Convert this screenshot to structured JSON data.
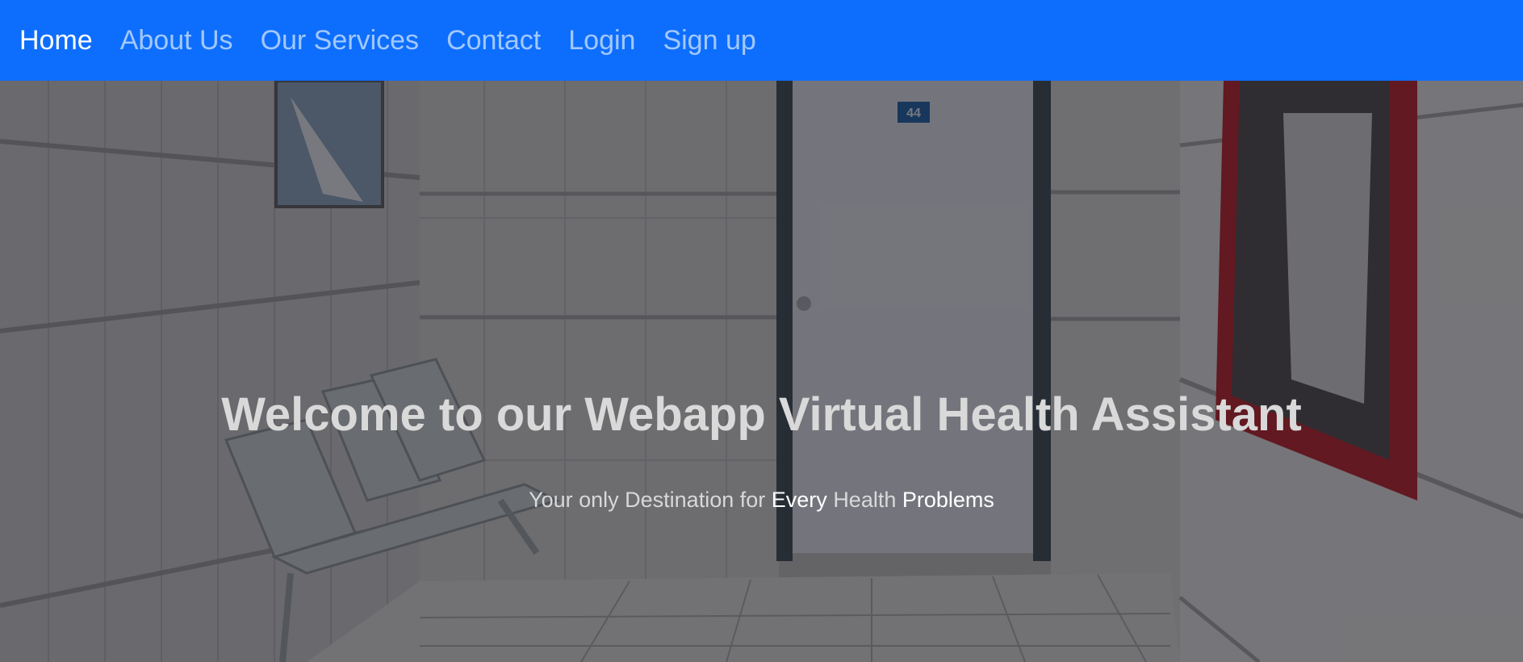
{
  "nav": {
    "items": [
      {
        "label": "Home",
        "active": true
      },
      {
        "label": "About Us",
        "active": false
      },
      {
        "label": "Our Services",
        "active": false
      },
      {
        "label": "Contact",
        "active": false
      },
      {
        "label": "Login",
        "active": false
      },
      {
        "label": "Sign up",
        "active": false
      }
    ]
  },
  "hero": {
    "headline_part1": "Welcome to our Webapp",
    "headline_part2": "Virtual Health Assistant",
    "subline_1": "Your only Destination for",
    "subline_2": "Every",
    "subline_3": "Health",
    "subline_4": "Problems",
    "door_number": "44"
  },
  "colors": {
    "navbar": "#0d6efd",
    "nav_active": "#ffffff",
    "nav_inactive": "#a9c9fb"
  }
}
